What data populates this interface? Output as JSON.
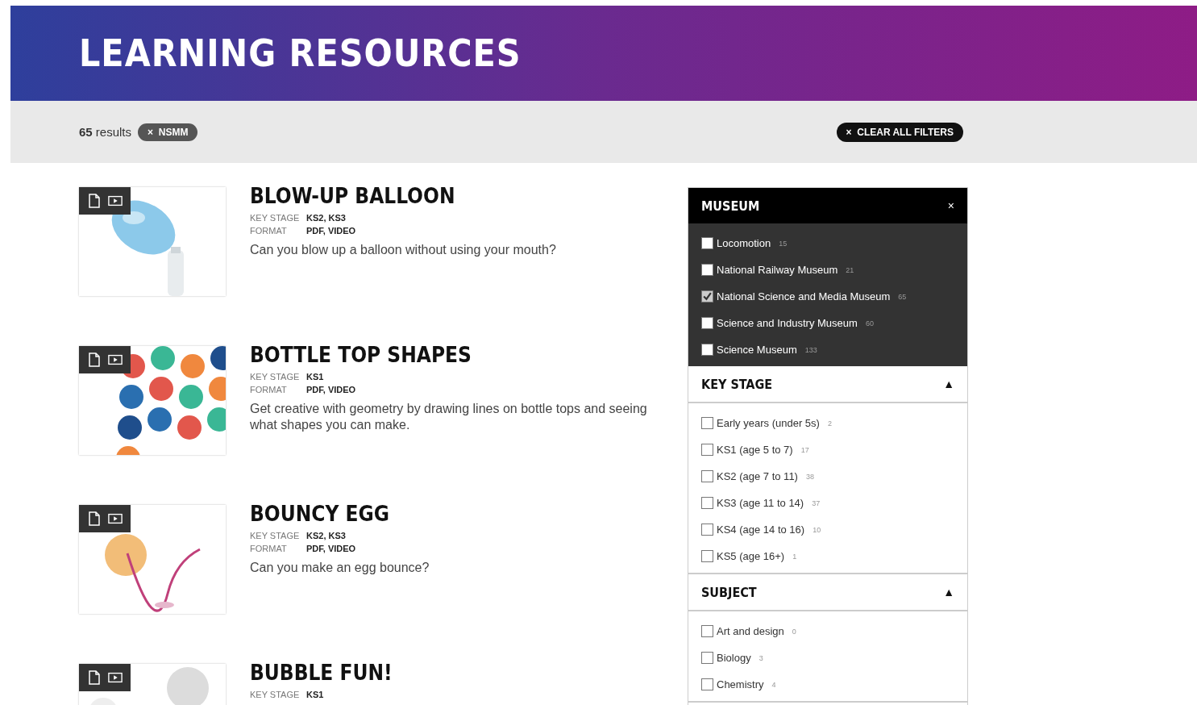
{
  "header": {
    "title": "LEARNING RESOURCES"
  },
  "filter_bar": {
    "results": "65",
    "results_label": "results",
    "active_filters": [
      {
        "icon": "×",
        "label": "NSMM"
      }
    ],
    "clear": {
      "icon": "×",
      "label": "CLEAR ALL FILTERS"
    }
  },
  "results": [
    {
      "title": "BLOW-UP BALLOON",
      "key_stage_label": "KEY STAGE",
      "key_stage": "KS2, KS3",
      "format_label": "FORMAT",
      "format": "PDF, VIDEO",
      "description": "Can you blow up a balloon without using your mouth?"
    },
    {
      "title": "BOTTLE TOP SHAPES",
      "key_stage_label": "KEY STAGE",
      "key_stage": "KS1",
      "format_label": "FORMAT",
      "format": "PDF, VIDEO",
      "description": "Get creative with geometry by drawing lines on bottle tops and seeing what shapes you can make."
    },
    {
      "title": "BOUNCY EGG",
      "key_stage_label": "KEY STAGE",
      "key_stage": "KS2, KS3",
      "format_label": "FORMAT",
      "format": "PDF, VIDEO",
      "description": "Can you make an egg bounce?"
    },
    {
      "title": "BUBBLE FUN!",
      "key_stage_label": "KEY STAGE",
      "key_stage": "KS1"
    }
  ],
  "filters": [
    {
      "title": "MUSEUM",
      "kind": "dark",
      "control": "×",
      "options": [
        {
          "label": "Locomotion",
          "count": "15",
          "checked": false
        },
        {
          "label": "National Railway Museum",
          "count": "21",
          "checked": false
        },
        {
          "label": "National Science and Media Museum",
          "count": "65",
          "checked": true
        },
        {
          "label": "Science and Industry Museum",
          "count": "60",
          "checked": false
        },
        {
          "label": "Science Museum",
          "count": "133",
          "checked": false
        }
      ]
    },
    {
      "title": "KEY STAGE",
      "kind": "light",
      "control": "▲",
      "options": [
        {
          "label": "Early years (under 5s)",
          "count": "2",
          "checked": false
        },
        {
          "label": "KS1 (age 5 to 7)",
          "count": "17",
          "checked": false
        },
        {
          "label": "KS2 (age 7 to 11)",
          "count": "38",
          "checked": false
        },
        {
          "label": "KS3 (age 11 to 14)",
          "count": "37",
          "checked": false
        },
        {
          "label": "KS4 (age 14 to 16)",
          "count": "10",
          "checked": false
        },
        {
          "label": "KS5 (age 16+)",
          "count": "1",
          "checked": false
        }
      ]
    },
    {
      "title": "SUBJECT",
      "kind": "light",
      "control": "▲",
      "options": [
        {
          "label": "Art and design",
          "count": "0",
          "checked": false
        },
        {
          "label": "Biology",
          "count": "3",
          "checked": false
        },
        {
          "label": "Chemistry",
          "count": "4",
          "checked": false
        }
      ]
    }
  ]
}
